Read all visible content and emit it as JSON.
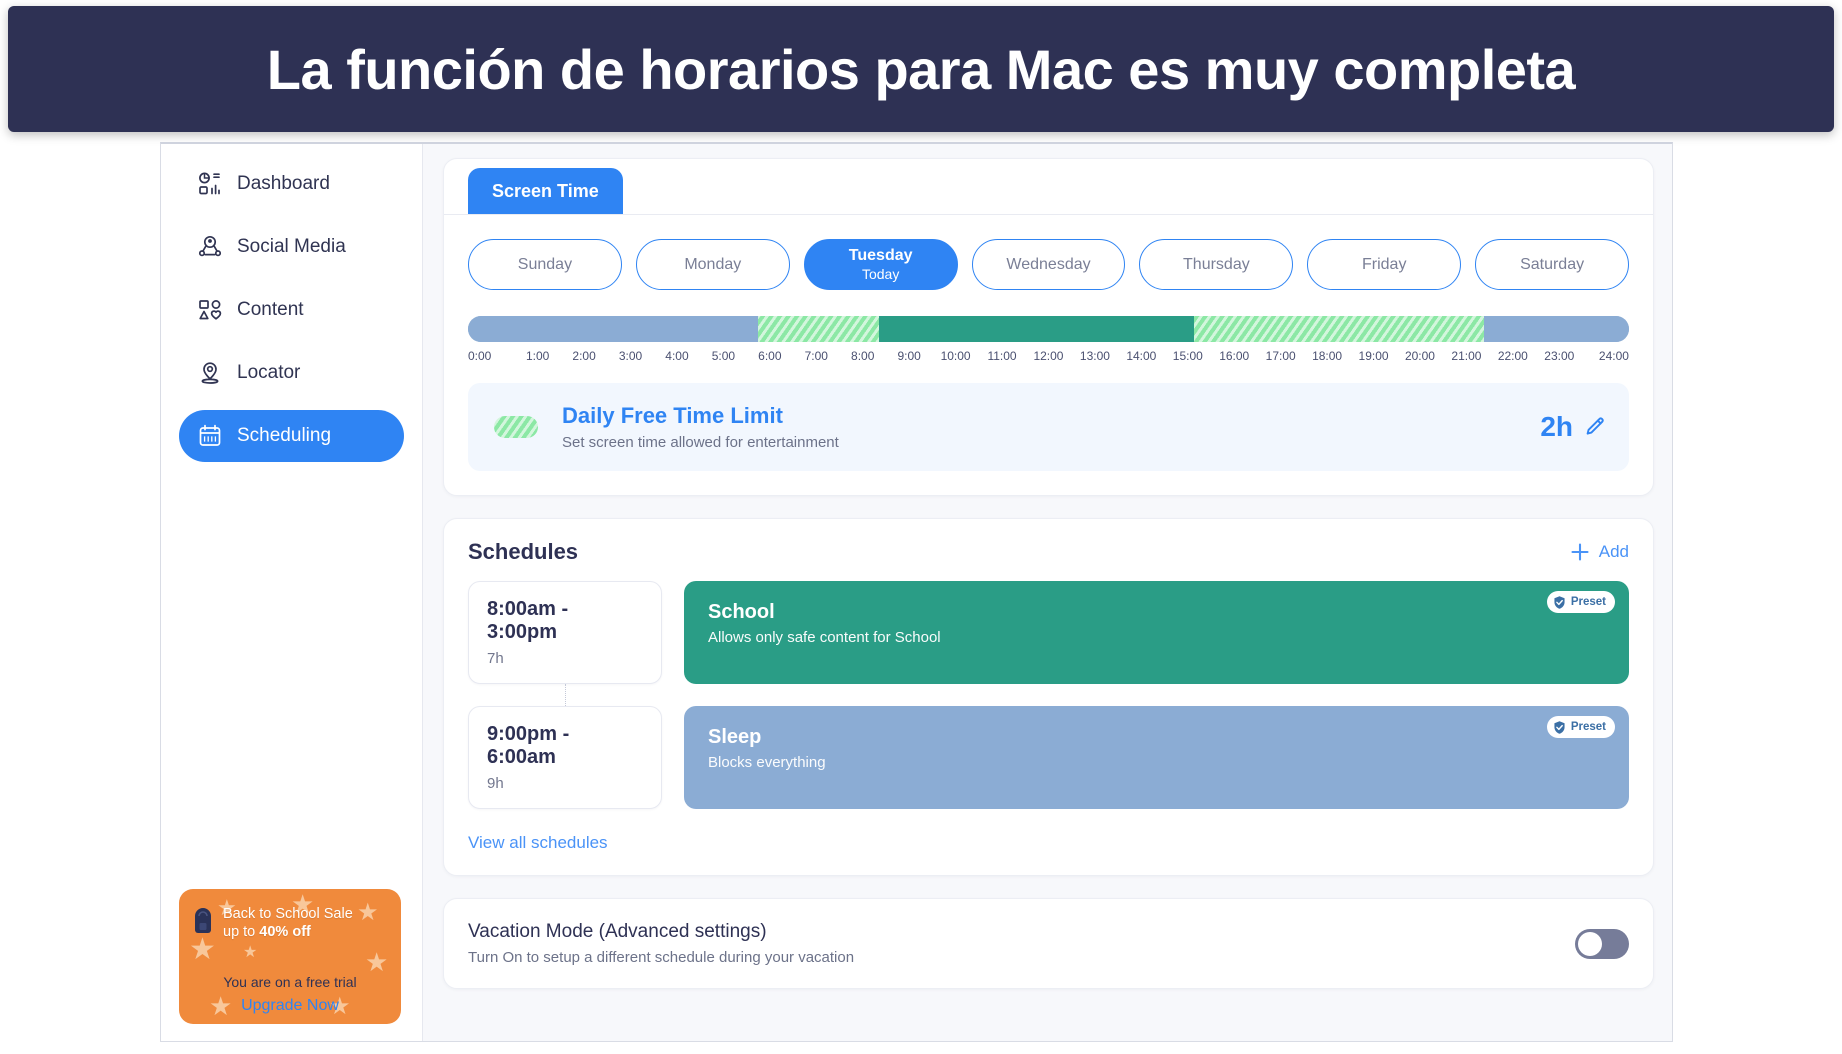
{
  "banner": {
    "text": "La función de horarios para Mac es muy completa"
  },
  "colors": {
    "banner_bg": "#2e3154",
    "accent_blue": "#2f84f3",
    "teal": "#2a9d86",
    "blue_grey": "#8bacd4",
    "hatch_green": "#8ce8a5",
    "promo_orange": "#f08a3c"
  },
  "sidebar": {
    "items": [
      {
        "label": "Dashboard",
        "icon": "dashboard-icon",
        "active": false
      },
      {
        "label": "Social Media",
        "icon": "social-media-icon",
        "active": false
      },
      {
        "label": "Content",
        "icon": "content-icon",
        "active": false
      },
      {
        "label": "Locator",
        "icon": "locator-icon",
        "active": false
      },
      {
        "label": "Scheduling",
        "icon": "calendar-icon",
        "active": true
      }
    ],
    "promo": {
      "headline_1": "Back to School Sale",
      "headline_2_prefix": "up to ",
      "headline_2_bold": "40% off",
      "trial_text": "You are on a free trial",
      "upgrade_label": "Upgrade Now"
    }
  },
  "main": {
    "tabs": [
      {
        "label": "Screen Time",
        "active": true
      }
    ],
    "days": [
      {
        "name": "Sunday",
        "sub": "",
        "selected": false
      },
      {
        "name": "Monday",
        "sub": "",
        "selected": false
      },
      {
        "name": "Tuesday",
        "sub": "Today",
        "selected": true
      },
      {
        "name": "Wednesday",
        "sub": "",
        "selected": false
      },
      {
        "name": "Thursday",
        "sub": "",
        "selected": false
      },
      {
        "name": "Friday",
        "sub": "",
        "selected": false
      },
      {
        "name": "Saturday",
        "sub": "",
        "selected": false
      }
    ],
    "timeline": {
      "hours": [
        "0:00",
        "1:00",
        "2:00",
        "3:00",
        "4:00",
        "5:00",
        "6:00",
        "7:00",
        "8:00",
        "9:00",
        "10:00",
        "11:00",
        "12:00",
        "13:00",
        "14:00",
        "15:00",
        "16:00",
        "17:00",
        "18:00",
        "19:00",
        "20:00",
        "21:00",
        "22:00",
        "23:00",
        "24:00"
      ],
      "segments": [
        {
          "type": "blue",
          "from": 0,
          "to": 6,
          "label": "Sleep"
        },
        {
          "type": "hatch",
          "from": 6,
          "to": 8.5,
          "label": "Free time"
        },
        {
          "type": "teal",
          "from": 8.5,
          "to": 15,
          "label": "School"
        },
        {
          "type": "hatch",
          "from": 15,
          "to": 21,
          "label": "Free time"
        },
        {
          "type": "blue",
          "from": 21,
          "to": 24,
          "label": "Sleep"
        }
      ]
    },
    "free_time_limit": {
      "title": "Daily Free Time Limit",
      "subtitle": "Set screen time allowed for entertainment",
      "value": "2h",
      "edit_icon": "pencil-icon"
    },
    "schedules": {
      "title": "Schedules",
      "add_label": "Add",
      "view_all_label": "View all schedules",
      "items": [
        {
          "time": "8:00am - 3:00pm",
          "duration": "7h",
          "name": "School",
          "description": "Allows only safe content for School",
          "badge": "Preset",
          "color": "teal"
        },
        {
          "time": "9:00pm - 6:00am",
          "duration": "9h",
          "name": "Sleep",
          "description": "Blocks everything",
          "badge": "Preset",
          "color": "blue_grey"
        }
      ]
    },
    "vacation": {
      "title": "Vacation Mode (Advanced settings)",
      "subtitle": "Turn On to setup a different schedule during your vacation",
      "enabled": false
    }
  }
}
